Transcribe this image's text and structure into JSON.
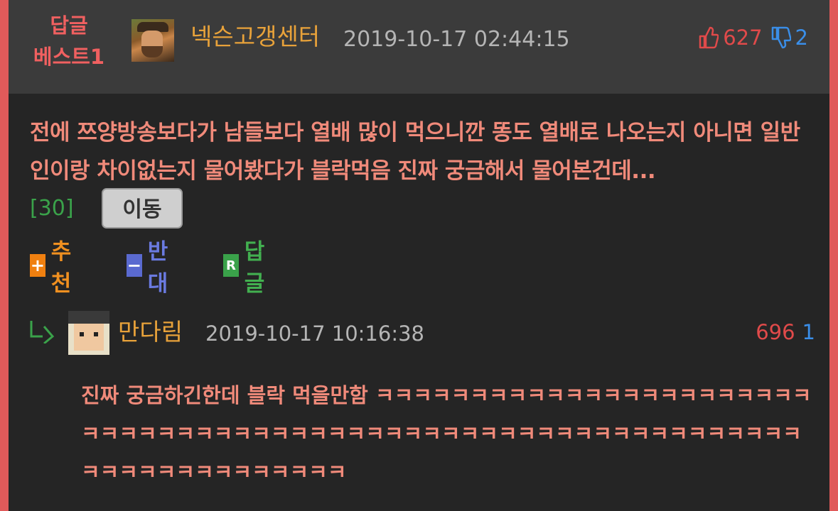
{
  "post": {
    "badge_line1": "답글",
    "badge_line2": "베스트1",
    "author": "넥슨고갱센터",
    "date": "2019-10-17 02:44:15",
    "upvotes": "627",
    "downvotes": "2",
    "content": "전에 쯔양방송보다가 남들보다 열배 많이 먹으니깐 똥도 열배로 나오는지 아니면 일반인이랑 차이없는지 물어봤다가 블락먹음 진짜 궁금해서 물어본건데...",
    "comment_count": "[30]",
    "move_label": "이동"
  },
  "actions": {
    "recommend_label": "추천",
    "oppose_label": "반대",
    "reply_label": "답글",
    "recommend_icon": "+",
    "oppose_icon": "−",
    "reply_icon": "R"
  },
  "reply": {
    "author": "만다림",
    "date": "2019-10-17 10:16:38",
    "upvotes": "696",
    "downvotes": "1",
    "content": "진짜 궁금하긴한데 블락 먹을만함 ㅋㅋㅋㅋㅋㅋㅋㅋㅋㅋㅋㅋㅋㅋㅋㅋㅋㅋㅋㅋㅋㅋㅋㅋㅋㅋㅋㅋㅋㅋㅋㅋㅋㅋㅋㅋㅋㅋㅋㅋㅋㅋㅋㅋㅋㅋㅋㅋㅋㅋㅋㅋㅋㅋㅋㅋㅋㅋㅋㅋㅋㅋㅋㅋㅋㅋㅋㅋㅋㅋㅋㅋㅋㅋㅋ"
  },
  "colors": {
    "accent_border": "#e05a5a",
    "nick": "#e8a23a",
    "content": "#f08a7a",
    "upvote": "#e04a4a",
    "downvote": "#3a8ee8"
  }
}
